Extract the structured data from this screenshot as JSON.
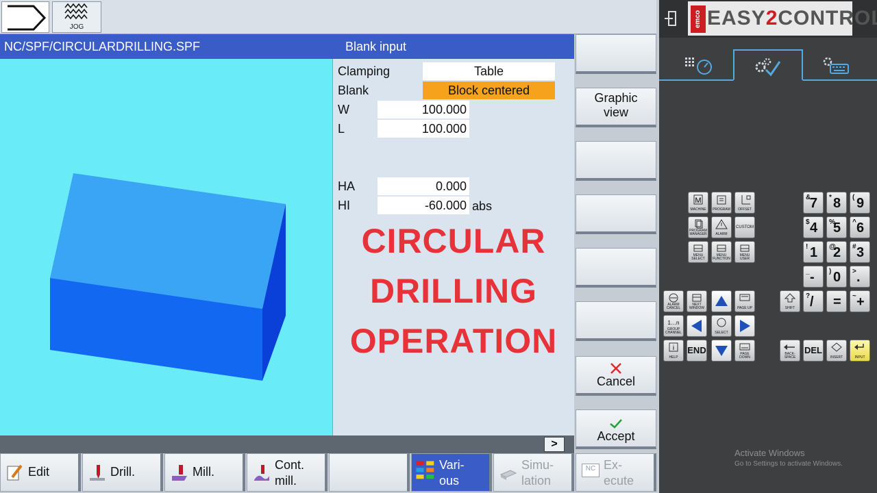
{
  "topbar": {
    "jog_label": "JOG"
  },
  "titlebar": {
    "path": "NC/SPF/CIRCULARDRILLING.SPF",
    "dialog": "Blank input"
  },
  "form": {
    "clamping_label": "Clamping",
    "clamping_value": "Table",
    "blank_label": "Blank",
    "blank_value": "Block centered",
    "w_label": "W",
    "w_value": "100.000",
    "l_label": "L",
    "l_value": "100.000",
    "ha_label": "HA",
    "ha_value": "0.000",
    "hi_label": "HI",
    "hi_value": "-60.000",
    "hi_unit": "abs"
  },
  "overlay": {
    "line1": "CIRCULAR",
    "line2": "DRILLING",
    "line3": "OPERATION"
  },
  "status": {
    "more": ">"
  },
  "vertical_softkeys": {
    "graphic_view_1": "Graphic",
    "graphic_view_2": "view",
    "cancel": "Cancel",
    "accept": "Accept"
  },
  "horizontal_softkeys": {
    "edit": "Edit",
    "drill": "Drill.",
    "mill": "Mill.",
    "cont_mill_1": "Cont.",
    "cont_mill_2": "mill.",
    "various_1": "Vari-",
    "various_2": "ous",
    "simulation_1": "Simu-",
    "simulation_2": "lation",
    "execute_1": "Ex-",
    "execute_2": "ecute",
    "execute_icon": "NC"
  },
  "panel": {
    "brand_emco": "emco",
    "brand_easy": "EASY",
    "brand_two": "2",
    "brand_control": "CONTROL",
    "keys": {
      "machine": "MACHINE",
      "program": "PROGRAM",
      "offset": "OFFSET",
      "program_manager": "PROGRAM MANAGER",
      "alarm": "ALARM",
      "custom": "CUSTOM",
      "menu_select": "MENU SELECT",
      "menu_function": "MENU FUNCTION",
      "menu_user": "MENU USER",
      "alarm_cancel": "ALARM CANCEL",
      "next_window": "NEXT WINDOW",
      "page_up": "PAGE UP",
      "group_channel": "GROUP CHANNEL",
      "select": "SELECT",
      "help": "HELP",
      "end": "END",
      "page_down": "PAGE DOWN",
      "shift": "SHIFT",
      "backspace": "BACK-SPACE",
      "del": "DEL",
      "insert": "INSERT",
      "input": "INPUT"
    },
    "numpad": [
      {
        "main": "7",
        "sup": "&"
      },
      {
        "main": "8",
        "sup": "*"
      },
      {
        "main": "9",
        "sup": "("
      },
      {
        "main": "4",
        "sup": "$"
      },
      {
        "main": "5",
        "sup": "%"
      },
      {
        "main": "6",
        "sup": "^"
      },
      {
        "main": "1",
        "sup": "!"
      },
      {
        "main": "2",
        "sup": "@"
      },
      {
        "main": "3",
        "sup": "#"
      },
      {
        "main": "-",
        "sup": "_"
      },
      {
        "main": "0",
        "sup": ")"
      },
      {
        "main": ".",
        "sup": ">"
      },
      {
        "main": "/",
        "sup": "?"
      },
      {
        "main": "=",
        "sup": ""
      },
      {
        "main": "+",
        "sup": "~"
      }
    ],
    "activate_title": "Activate Windows",
    "activate_sub": "Go to Settings to activate Windows."
  },
  "colors": {
    "title_blue": "#3a5cc6",
    "graphic_cyan": "#69ecf7",
    "blank_orange": "#f7a21c",
    "overlay_red": "#e8323a"
  }
}
